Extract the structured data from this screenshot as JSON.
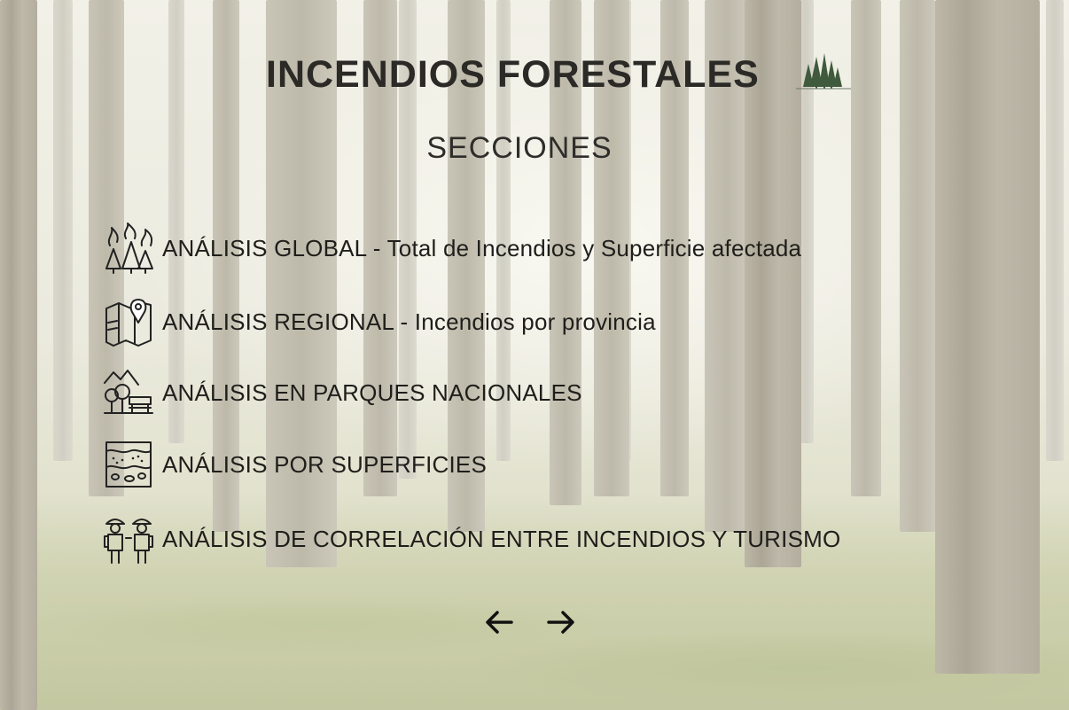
{
  "page": {
    "title": "INCENDIOS FORESTALES",
    "title_icon": "pine-trees-icon",
    "sections_heading": "SECCIONES"
  },
  "menu": {
    "items": [
      {
        "label": "ANÁLISIS GLOBAL - Total de Incendios y Superficie afectada",
        "icon": "forest-fire-icon"
      },
      {
        "label": "ANÁLISIS REGIONAL - Incendios por provincia",
        "icon": "map-pin-icon"
      },
      {
        "label": "ANÁLISIS EN PARQUES NACIONALES",
        "icon": "national-park-icon"
      },
      {
        "label": "ANÁLISIS POR SUPERFICIES",
        "icon": "soil-layers-icon"
      },
      {
        "label": "ANÁLISIS DE CORRELACIÓN ENTRE INCENDIOS Y TURISMO",
        "icon": "tourists-icon"
      }
    ]
  },
  "navigation": {
    "prev_icon": "arrow-left-icon",
    "next_icon": "arrow-right-icon"
  },
  "colors": {
    "text": "#1f1e1b",
    "title": "#2b2a27",
    "icon_green": "#3f5a3c"
  }
}
